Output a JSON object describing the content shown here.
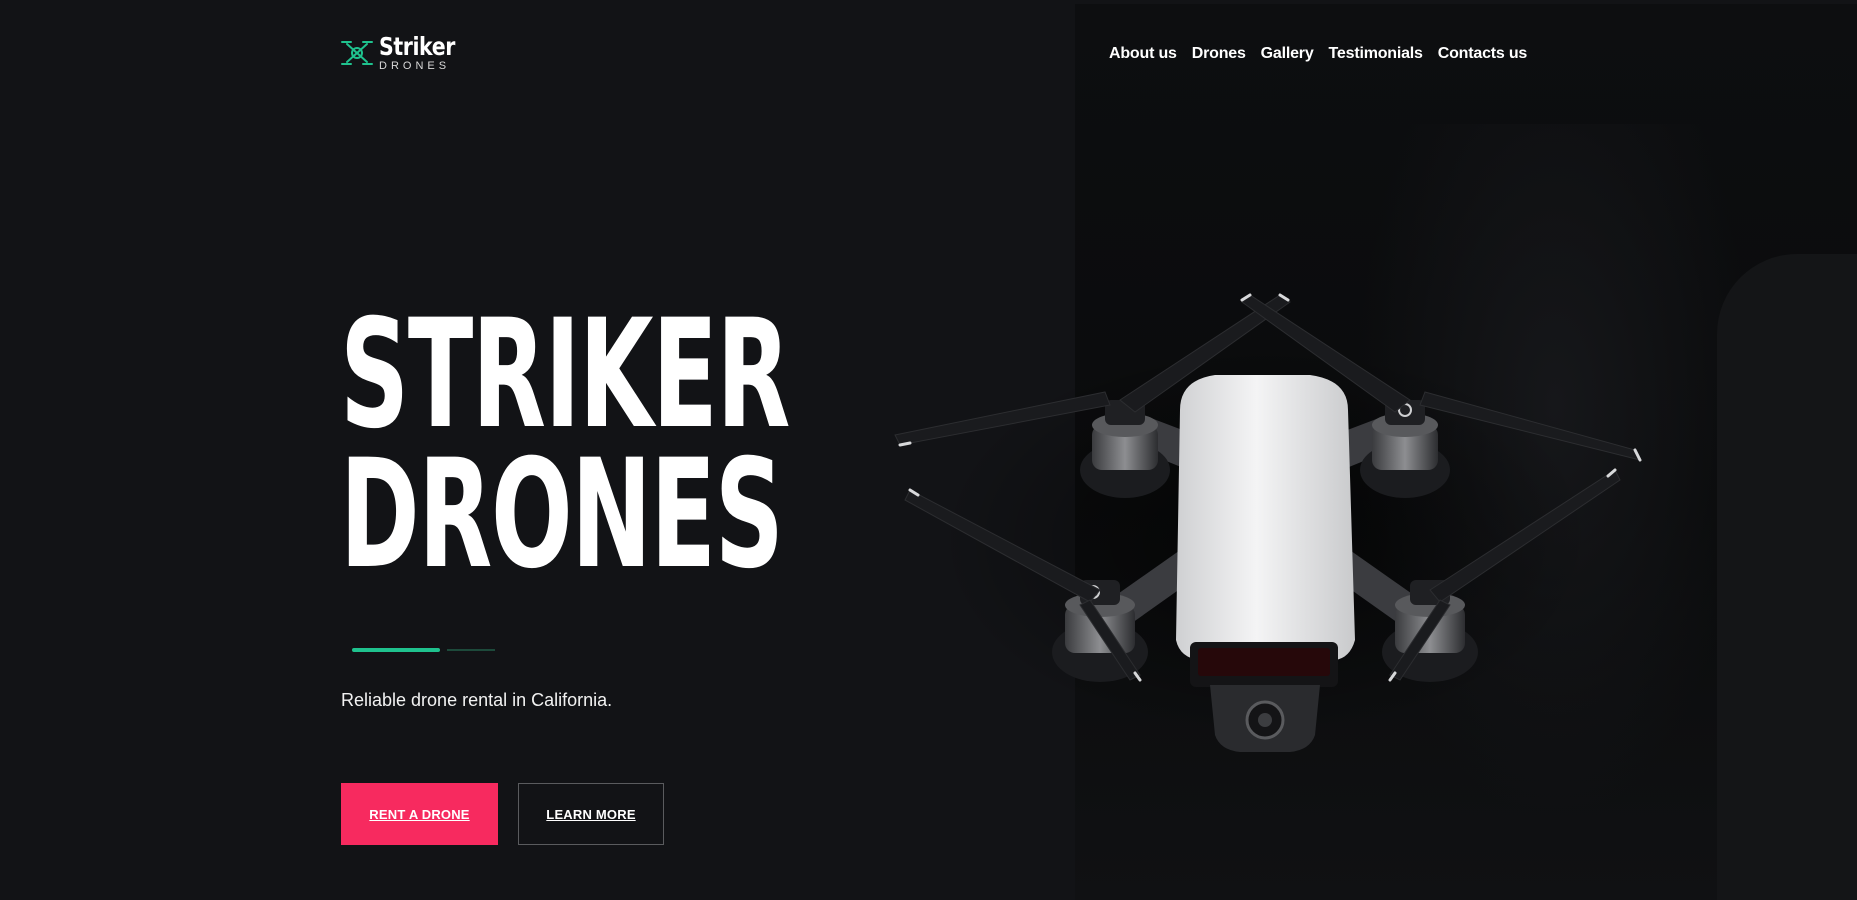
{
  "brand": {
    "name": "Striker",
    "sub": "DRONES",
    "accent": "#1fc28e"
  },
  "nav": {
    "items": [
      {
        "label": "About us"
      },
      {
        "label": "Drones"
      },
      {
        "label": "Gallery"
      },
      {
        "label": "Testimonials"
      },
      {
        "label": "Contacts us"
      }
    ]
  },
  "hero": {
    "title_line1": "STRIKER",
    "title_line2": "DRONES",
    "subtitle": "Reliable drone rental in California.",
    "primary_button": "RENT A DRONE",
    "secondary_button": "LEARN MORE",
    "primary_color": "#f72a5f"
  },
  "icons": {
    "logo": "drone-logo-icon",
    "hero_image": "drone-image"
  }
}
